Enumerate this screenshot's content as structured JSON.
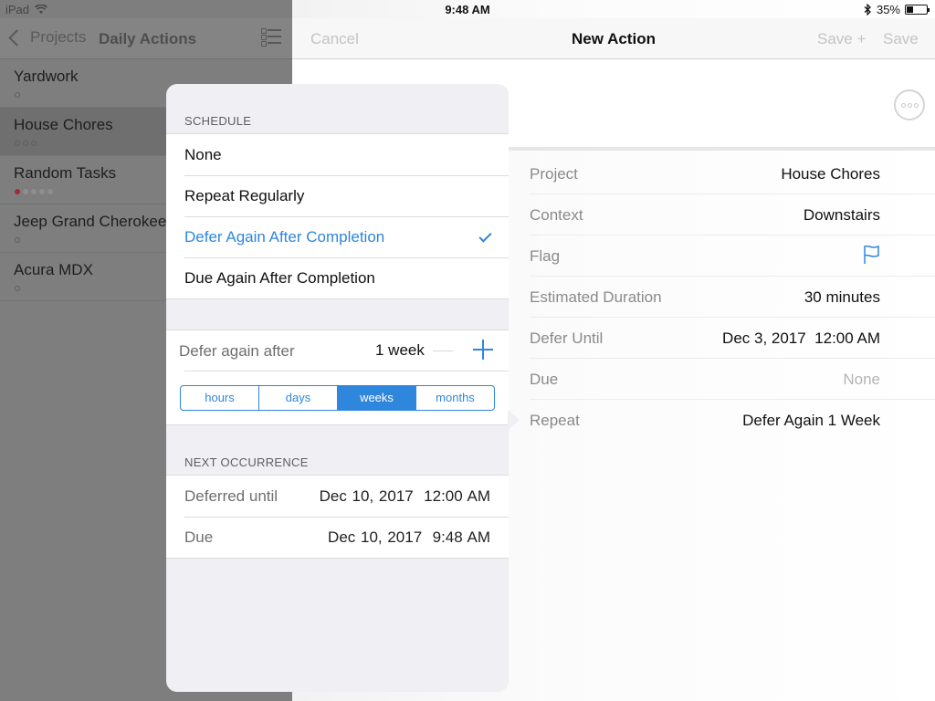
{
  "status_bar": {
    "device": "iPad",
    "time": "9:48 AM",
    "battery": "35%",
    "battery_level": 0.35
  },
  "left_pane": {
    "back_label": "Projects",
    "title": "Daily Actions",
    "items": [
      {
        "name": "Yardwork",
        "dots": [
          "hollow"
        ]
      },
      {
        "name": "House Chores",
        "dots": [
          "hollow",
          "hollow",
          "hollow"
        ]
      },
      {
        "name": "Random Tasks",
        "dots": [
          "red",
          "gray",
          "gray",
          "gray",
          "gray"
        ]
      },
      {
        "name": "Jeep Grand Cherokee",
        "dots": [
          "hollow"
        ]
      },
      {
        "name": "Acura MDX",
        "dots": [
          "hollow"
        ]
      }
    ]
  },
  "right_pane": {
    "cancel_label": "Cancel",
    "title": "New Action",
    "save_plus_label": "Save +",
    "save_label": "Save",
    "rows": [
      {
        "label": "Project",
        "value": "House Chores"
      },
      {
        "label": "Context",
        "value": "Downstairs"
      },
      {
        "label": "Flag",
        "value": ""
      },
      {
        "label": "Estimated Duration",
        "value": "30 minutes"
      },
      {
        "label": "Defer Until",
        "value": "Dec 3, 2017  12:00 AM"
      },
      {
        "label": "Due",
        "value": "None"
      },
      {
        "label": "Repeat",
        "value": "Defer Again 1 Week"
      }
    ]
  },
  "popover": {
    "schedule_header": "SCHEDULE",
    "options": [
      {
        "label": "None",
        "selected": false
      },
      {
        "label": "Repeat Regularly",
        "selected": false
      },
      {
        "label": "Defer Again After Completion",
        "selected": true
      },
      {
        "label": "Due Again After Completion",
        "selected": false
      }
    ],
    "interval_label": "Defer again after",
    "interval_value": "1 week",
    "units": [
      "hours",
      "days",
      "weeks",
      "months"
    ],
    "selected_unit": "weeks",
    "next_header": "NEXT OCCURRENCE",
    "next": [
      {
        "label": "Deferred until",
        "value": "Dec 10, 2017  12:00 AM"
      },
      {
        "label": "Due",
        "value": "Dec 10, 2017  9:48 AM"
      }
    ]
  },
  "colors": {
    "accent": "#2f86dd",
    "flag_red": "#a8283a"
  }
}
